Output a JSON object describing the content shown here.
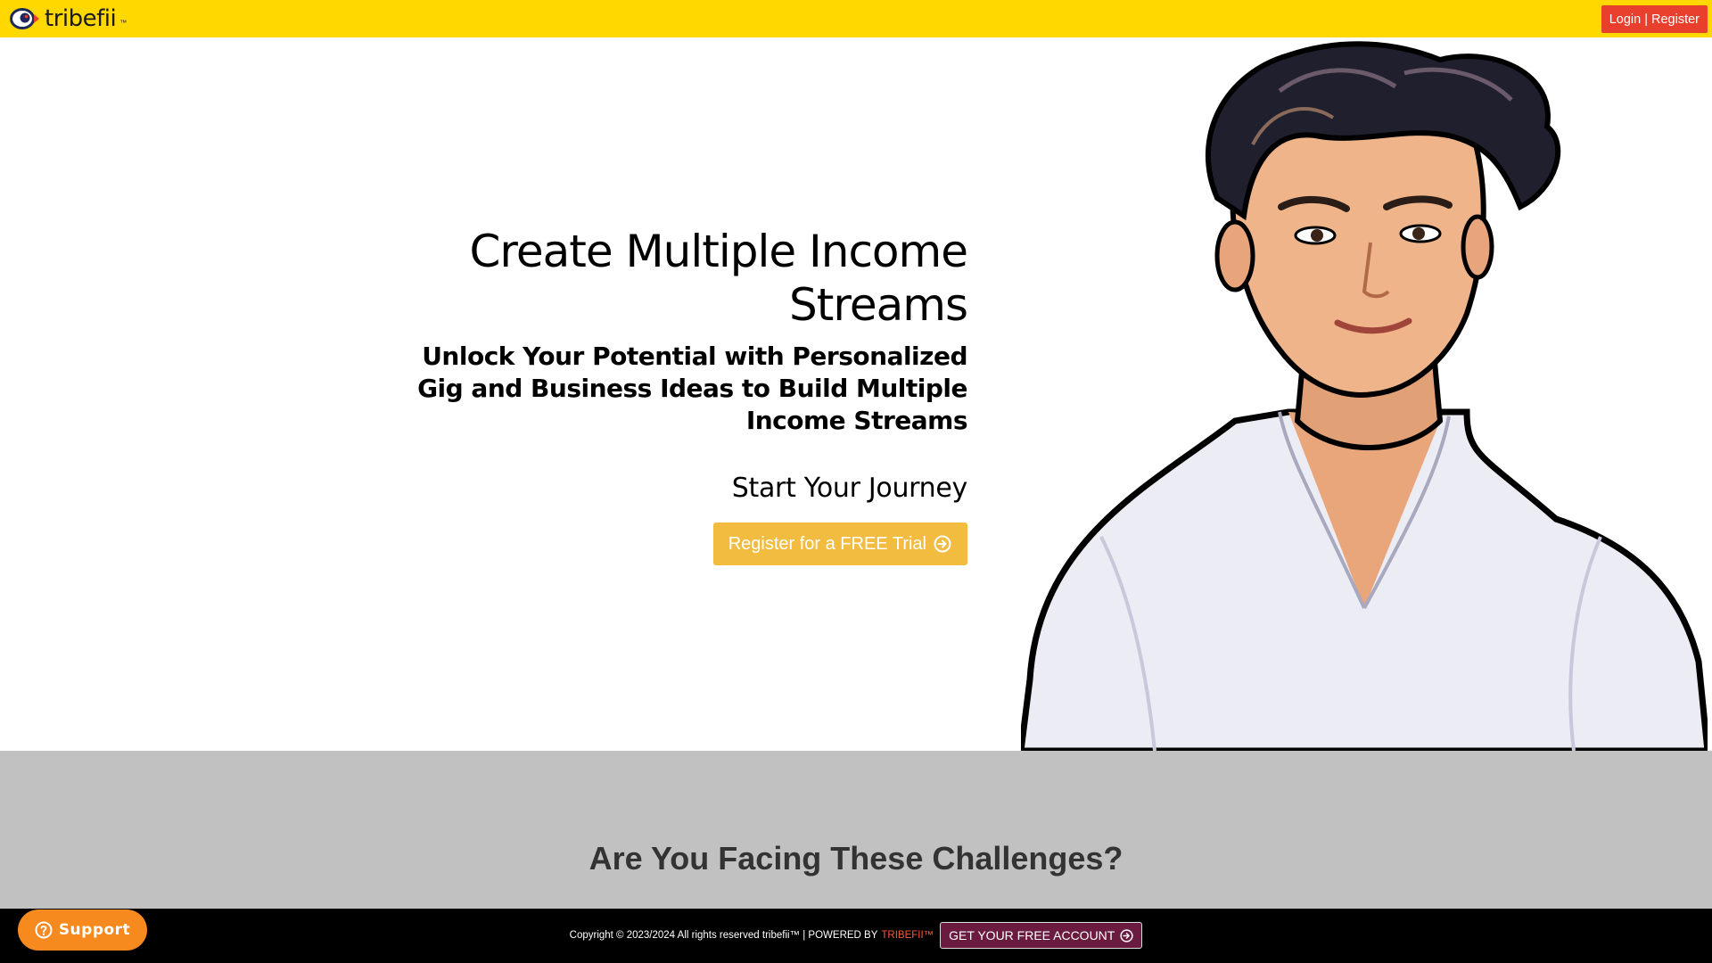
{
  "header": {
    "logo_text": "tribefii",
    "logo_tm": "™",
    "login_label": "Login | Register"
  },
  "hero": {
    "title": "Create Multiple Income Streams",
    "subtitle": "Unlock Your Potential with Personalized Gig and Business Ideas to Build Multiple Income Streams",
    "journey": "Start Your Journey",
    "cta_label": "Register for a FREE Trial",
    "cta_icon": "arrow-circle-right-icon"
  },
  "challenges": {
    "title": "Are You Facing These Challenges?"
  },
  "footer": {
    "copyright": "Copyright © 2023/2024 All rights reserved tribefii™ | POWERED BY",
    "powered_brand": "TRIBEFII™",
    "account_label": "GET YOUR FREE ACCOUNT",
    "account_icon": "arrow-circle-right-icon"
  },
  "support": {
    "label": "Support",
    "icon": "help-circle-icon"
  },
  "colors": {
    "header_bg": "#ffd800",
    "login_bg": "#e8402c",
    "cta_bg": "#f2bc41",
    "challenges_bg": "#c1c1c1",
    "footer_bg": "#000000",
    "footer_brand": "#f25d3a",
    "footer_button_bg": "#6a1b3f",
    "support_bg": "#f68a1f"
  }
}
